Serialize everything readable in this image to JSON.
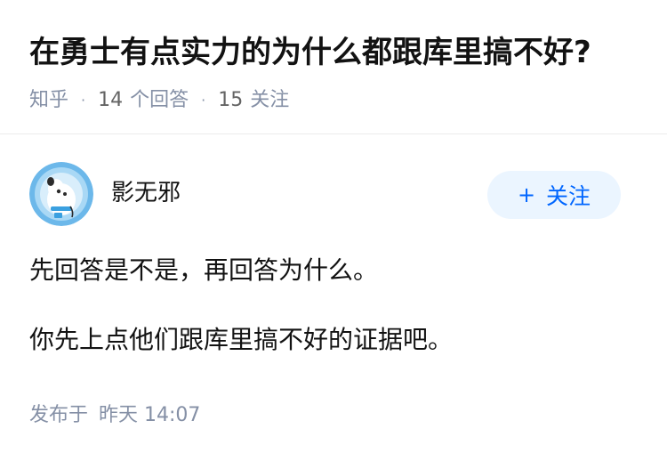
{
  "question": {
    "title": "在勇士有点实力的为什么都跟库里搞不好?",
    "source": "知乎",
    "answers_count": "14",
    "answers_label": "个回答",
    "followers_count": "15",
    "followers_label": "关注"
  },
  "answer": {
    "author_name": "影无邪",
    "follow_button_label": "关注",
    "follow_button_icon": "plus-icon",
    "paragraphs": [
      "先回答是不是，再回答为什么。",
      "你先上点他们跟库里搞不好的证据吧。"
    ],
    "publish_label": "发布于",
    "publish_time": "昨天 14:07"
  },
  "colors": {
    "title": "#121212",
    "meta": "#8590a6",
    "follow_bg": "#ebf5ff",
    "follow_text": "#0066ff",
    "divider": "#ebebeb"
  }
}
